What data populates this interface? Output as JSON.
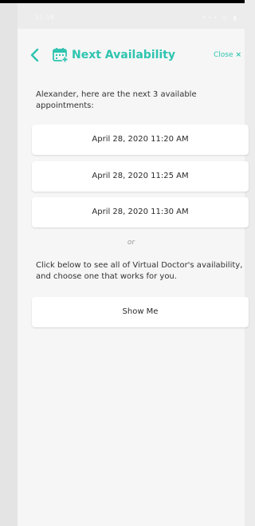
{
  "status_bar": {
    "time": "11:18",
    "icons": "••• ᯤ ▮"
  },
  "header": {
    "back_icon": "chevron-left-icon",
    "title": "Next Availability",
    "close_label": "Close",
    "close_icon": "×",
    "accent_color": "#2ec4b0"
  },
  "intro_text": "Alexander, here are the next 3 available appointments:",
  "appointments": [
    {
      "label": "April 28, 2020 11:20 AM"
    },
    {
      "label": "April 28, 2020 11:25 AM"
    },
    {
      "label": "April 28, 2020 11:30 AM"
    }
  ],
  "divider_text": "or",
  "instruction_text": "Click below to see all of Virtual Doctor's availability, and choose one that works for you.",
  "show_me_label": "Show Me"
}
